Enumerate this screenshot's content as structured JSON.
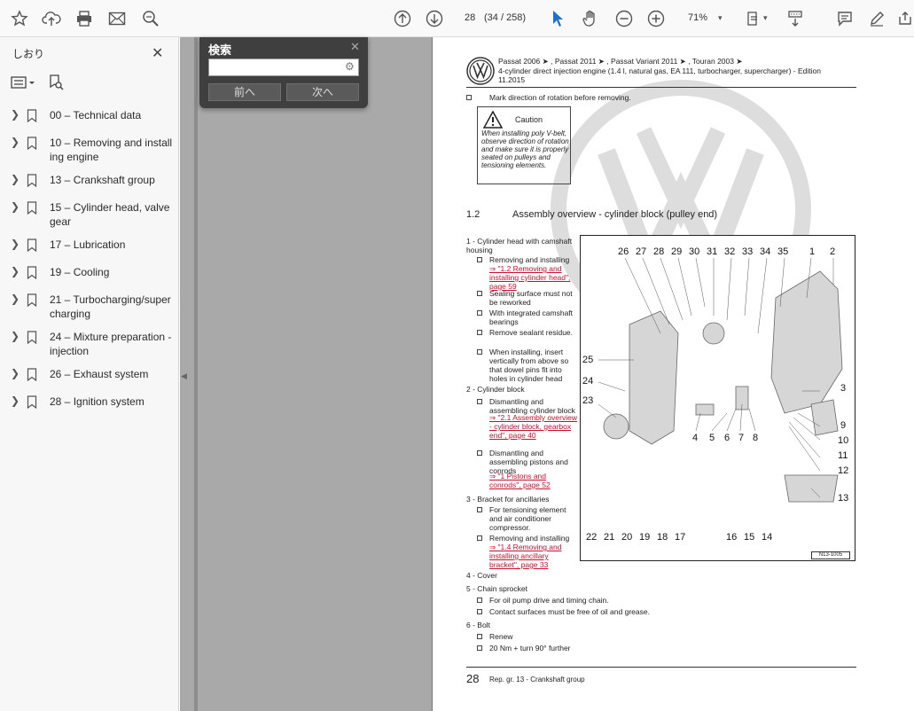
{
  "toolbar": {
    "page_current": "28",
    "page_info": "(34 / 258)",
    "zoom": "71%"
  },
  "sidebar": {
    "title": "しおり",
    "bookmarks": [
      {
        "label": "00 – Technical data"
      },
      {
        "label": "10 – Removing and installing engine"
      },
      {
        "label": "13 – Crankshaft group"
      },
      {
        "label": "15 – Cylinder head, valve gear"
      },
      {
        "label": "17 – Lubrication"
      },
      {
        "label": "19 – Cooling"
      },
      {
        "label": "21 – Turbocharging/supercharging"
      },
      {
        "label": "24 – Mixture preparation - injection"
      },
      {
        "label": "26 – Exhaust system"
      },
      {
        "label": "28 – Ignition system"
      }
    ]
  },
  "search": {
    "title": "検索",
    "value": "",
    "prev_label": "前へ",
    "next_label": "次へ"
  },
  "page": {
    "header_line1": "Passat 2006 ➤ , Passat 2011 ➤ , Passat Variant 2011 ➤ , Touran 2003 ➤",
    "header_line2": "4-cylinder direct injection engine (1.4 l, natural gas, EA 111, turbocharger, supercharger) - Edition",
    "header_line3": "11.2015",
    "item_mark": "Mark direction of rotation before removing.",
    "caution_title": "Caution",
    "caution_text": "When installing poly V-belt, observe direction of rotation and make sure it is properly seated on pulleys and tensioning elements.",
    "section_number": "1.2",
    "section_title": "Assembly overview - cylinder block (pulley end)",
    "left_items": [
      {
        "text": "1 - Cylinder head with camshaft housing",
        "bold": false
      },
      {
        "text": "Removing and installing",
        "type": "check"
      },
      {
        "text": "⇒ \"1.2 Removing and installing cylinder head\", page 59",
        "type": "link"
      },
      {
        "text": "Sealing surface must not be reworked",
        "type": "check"
      },
      {
        "text": "With integrated camshaft bearings",
        "type": "check"
      },
      {
        "text": "Remove sealant residue.",
        "type": "check"
      },
      {
        "text": "When installing, insert vertically from above so that dowel pins fit into holes in cylinder head",
        "type": "check"
      },
      {
        "text": "2 - Cylinder block"
      },
      {
        "text": "Dismantling and assembling cylinder block",
        "type": "check"
      },
      {
        "text": "⇒ \"2.1 Assembly overview - cylinder block, gearbox end\", page 40",
        "type": "link"
      },
      {
        "text": "Dismantling and assembling pistons and conrods",
        "type": "check"
      },
      {
        "text": "⇒ \"1 Pistons and conrods\", page 52",
        "type": "link"
      },
      {
        "text": "3 - Bracket for ancillaries"
      },
      {
        "text": "For tensioning element and air conditioner compressor.",
        "type": "check"
      },
      {
        "text": "Removing and installing",
        "type": "check"
      },
      {
        "text": "⇒ \"1.4 Removing and installing ancillary bracket\", page 33",
        "type": "link"
      }
    ],
    "bottom_items": [
      {
        "text": "4 - Cover"
      },
      {
        "text": "5 - Chain sprocket"
      },
      {
        "text": "For oil pump drive and timing chain.",
        "type": "check"
      },
      {
        "text": "Contact surfaces must be free of oil and grease.",
        "type": "check"
      },
      {
        "text": "6 - Bolt"
      },
      {
        "text": "Renew",
        "type": "check"
      },
      {
        "text": "20 Nm + turn 90° further",
        "type": "check"
      }
    ],
    "callouts": [
      "26",
      "27",
      "28",
      "29",
      "30",
      "31",
      "32",
      "33",
      "34",
      "35",
      "1",
      "2",
      "25",
      "24",
      "23",
      "3",
      "9",
      "10",
      "11",
      "12",
      "13",
      "4",
      "5",
      "6",
      "7",
      "8",
      "22",
      "21",
      "20",
      "19",
      "18",
      "17",
      "16",
      "15",
      "14"
    ],
    "diagram_ref": "N13-1005",
    "footer_page": "28",
    "footer_text": "Rep. gr. 13 - Crankshaft group"
  }
}
